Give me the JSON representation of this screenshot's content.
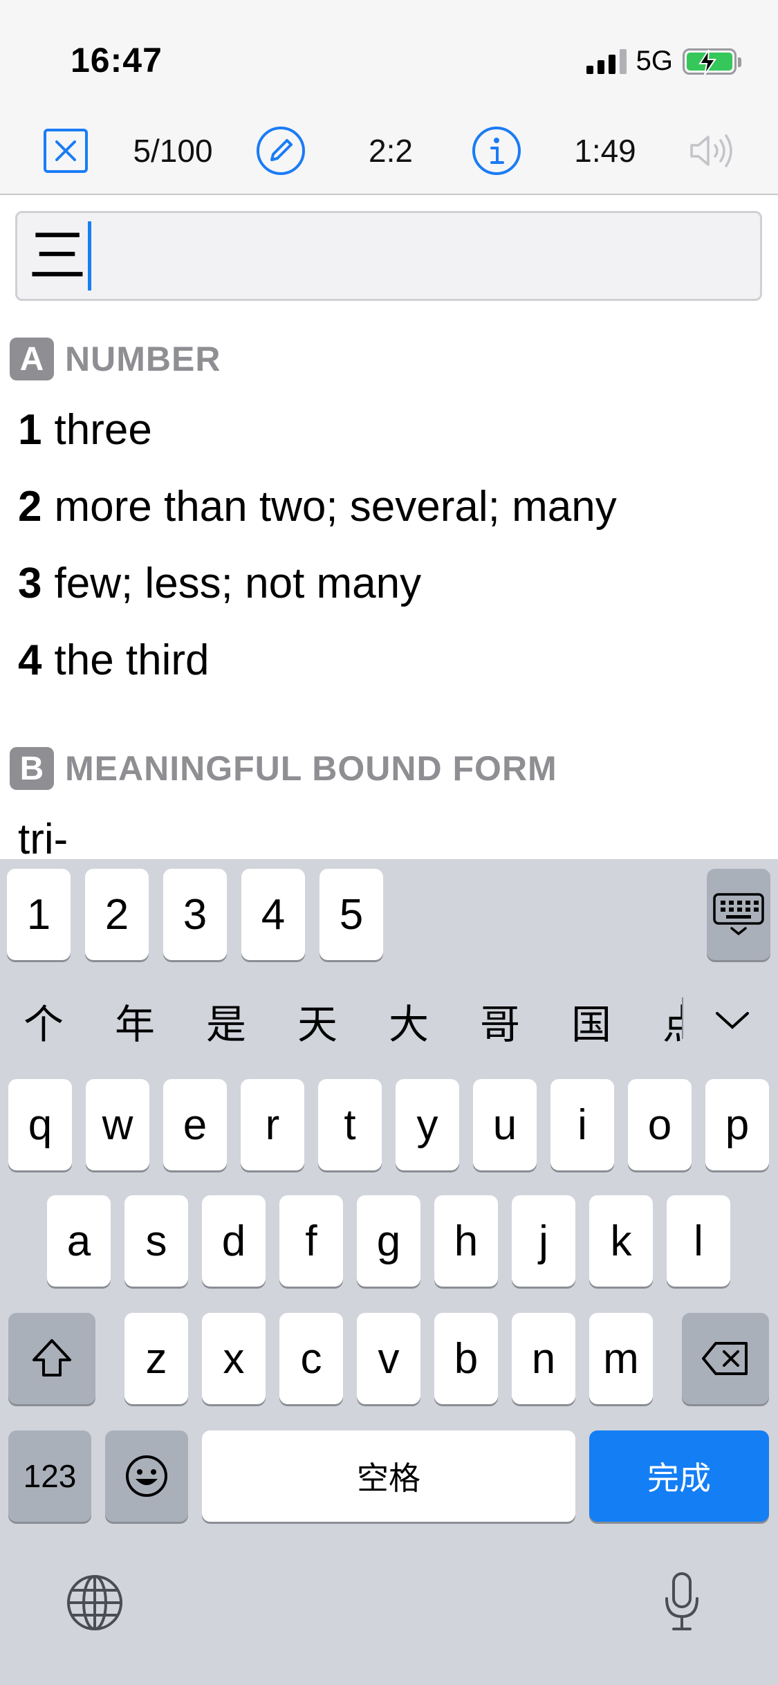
{
  "status_bar": {
    "time": "16:47",
    "network": "5G"
  },
  "toolbar": {
    "progress": "5/100",
    "ratio": "2:2",
    "timer": "1:49"
  },
  "input": {
    "value": "三"
  },
  "sections": [
    {
      "letter": "A",
      "title": "NUMBER",
      "definitions": [
        {
          "num": "1",
          "text": "three"
        },
        {
          "num": "2",
          "text": "more than two; several; many"
        },
        {
          "num": "3",
          "text": "few; less; not many"
        },
        {
          "num": "4",
          "text": "the third"
        }
      ]
    },
    {
      "letter": "B",
      "title": "MEANINGFUL BOUND FORM",
      "definitions": [
        {
          "num": "",
          "text": "tri-"
        }
      ]
    }
  ],
  "keyboard": {
    "number_row": [
      "1",
      "2",
      "3",
      "4",
      "5"
    ],
    "candidates": [
      "个",
      "年",
      "是",
      "天",
      "大",
      "哥",
      "国",
      "点"
    ],
    "row1": [
      "q",
      "w",
      "e",
      "r",
      "t",
      "y",
      "u",
      "i",
      "o",
      "p"
    ],
    "row2": [
      "a",
      "s",
      "d",
      "f",
      "g",
      "h",
      "j",
      "k",
      "l"
    ],
    "row3": [
      "z",
      "x",
      "c",
      "v",
      "b",
      "n",
      "m"
    ],
    "numbers_key": "123",
    "space_key": "空格",
    "done_key": "完成"
  },
  "colors": {
    "accent": "#1a7cf5",
    "badge": "#8e8e93",
    "done": "#147ef5",
    "battery": "#35c759"
  }
}
